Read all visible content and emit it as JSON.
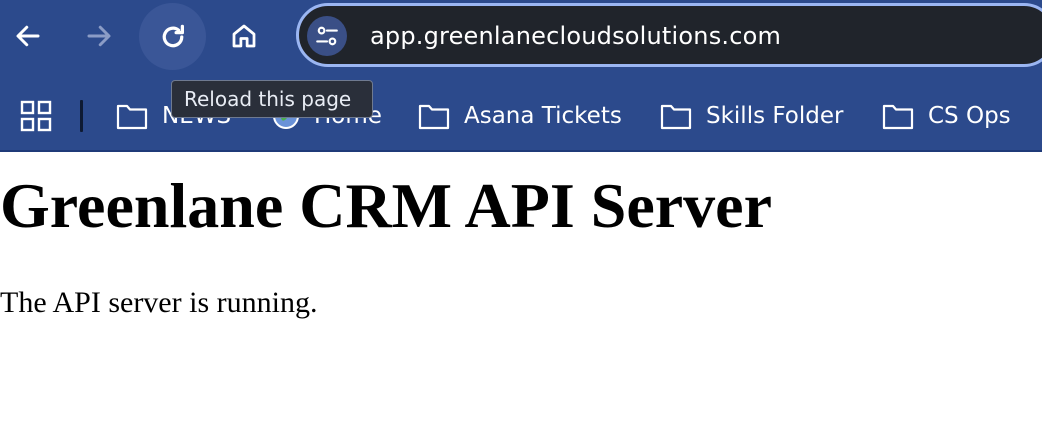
{
  "browser": {
    "url": "app.greenlanecloudsolutions.com",
    "tooltip": "Reload this page",
    "bookmarks": [
      {
        "label": "NEWS",
        "icon": "folder-icon"
      },
      {
        "label": "Home",
        "icon": "globe-icon"
      },
      {
        "label": "Asana Tickets",
        "icon": "folder-icon"
      },
      {
        "label": "Skills Folder",
        "icon": "folder-icon"
      },
      {
        "label": "CS Ops",
        "icon": "folder-icon"
      }
    ],
    "colors": {
      "chrome": "#2c4a8c",
      "omnibox": "#20242b",
      "omnibox_border": "#9bb6f2"
    }
  },
  "page": {
    "heading": "Greenlane CRM API Server",
    "message": "The API server is running."
  }
}
